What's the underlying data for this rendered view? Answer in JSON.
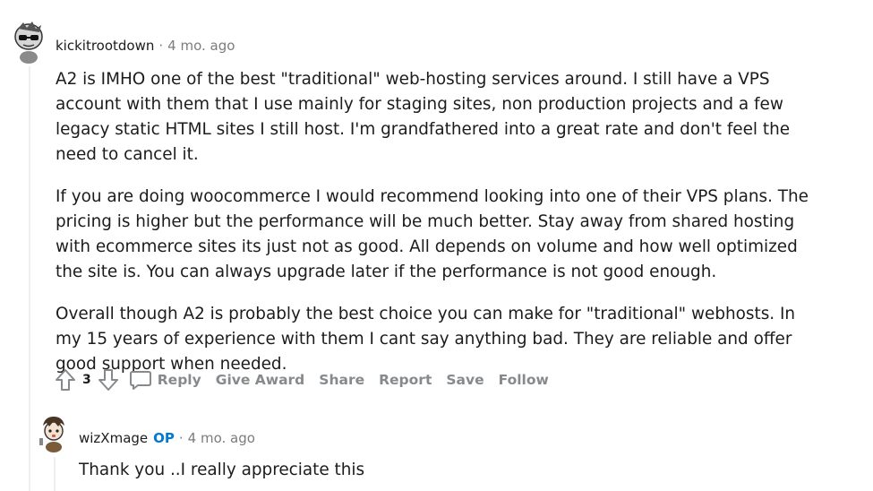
{
  "comment": {
    "author": "kickitrootdown",
    "separator": "·",
    "time": "4 mo. ago",
    "paragraphs": [
      "A2 is IMHO one of the best \"traditional\" web-hosting services around. I still have a VPS account with them that I use mainly for staging sites, non production projects and a few legacy static HTML sites I still host. I'm grandfathered into a great rate and don't feel the need to cancel it.",
      "If you are doing woocommerce I would recommend looking into one of their VPS plans. The pricing is higher but the performance will be much better. Stay away from shared hosting with ecommerce sites its just not as good. All depends on volume and how well optimized the site is. You can always upgrade later if the performance is not good enough.",
      "Overall though A2 is probably the best choice you can make for \"traditional\" webhosts. In my 15 years of experience with them I cant say anything bad. They are reliable and offer good support when needed."
    ],
    "score": "3",
    "actions": {
      "reply": "Reply",
      "give_award": "Give Award",
      "share": "Share",
      "report": "Report",
      "save": "Save",
      "follow": "Follow"
    }
  },
  "reply": {
    "author": "wizXmage",
    "badge": "OP",
    "separator": "·",
    "time": "4 mo. ago",
    "text": "Thank you ..I really appreciate this"
  },
  "colors": {
    "text": "#1c1c1c",
    "meta": "#7c7c7c",
    "action": "#878a8c",
    "op_badge": "#0079d3",
    "thread_line": "#edeff1"
  },
  "icons": [
    "avatar-kickitrootdown",
    "upvote-icon",
    "downvote-icon",
    "comment-bubble-icon",
    "avatar-wizxmage"
  ]
}
